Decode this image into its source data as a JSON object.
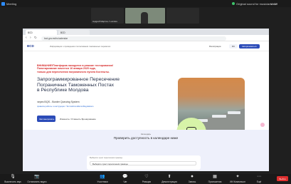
{
  "zoom": {
    "title": "Meeting",
    "original_sound": "Original sound for musicians: Off",
    "view": "View",
    "thumbnails": [
      "Андрей Мартин / Lumière",
      "",
      ""
    ],
    "controls": [
      "Выключить звук",
      "Остановить видео",
      "Участники",
      "Чат",
      "Реакции",
      "Демонстрация",
      "Запись",
      "Приложения",
      "ИИ Компаньон",
      "Ещё"
    ],
    "end": "Выйти"
  },
  "browser": {
    "tabs": [
      "BCD",
      "BCD"
    ],
    "url": "bcd.gov.md/ru/calendar"
  },
  "site": {
    "brand": "BCD",
    "tagline": "Информация о проведении согласования таможенных перевозок",
    "header_buttons": [
      "Регистрация",
      "RU",
      "Авторизоваться"
    ]
  },
  "hero": {
    "warn_line1": "ВНИМАНИЕ!Платформа находится в режиме тестирования!",
    "warn_line2": "Пилотирование начнется 16 января 2025 года,",
    "warn_line3": "только для пересечения пограничного пункта Костешты.",
    "title_line1": "Запрограммированное Пересечение",
    "title_line2": "Пограничных Таможенных Постах",
    "title_line3": "в Республике Молдова",
    "subtitle": "через BQS - Border Queuing System",
    "link": "правила работы и инструкции / Terms&Conditions/Regulations",
    "primary_button": "Запланировать",
    "secondary_link": "Изменить / Отменить Бронирование"
  },
  "lower": {
    "label": "Календарь",
    "title": "Проверить доступность в календаре ниже",
    "form_label": "Выберите пункт пересечения границы",
    "select_value": "Выберите пункт пересечения границы"
  },
  "colors": {
    "accent": "#2b4bb8",
    "warning": "#d62828",
    "circle": "#d7f3a8",
    "zoom_end": "#e02f2f"
  }
}
